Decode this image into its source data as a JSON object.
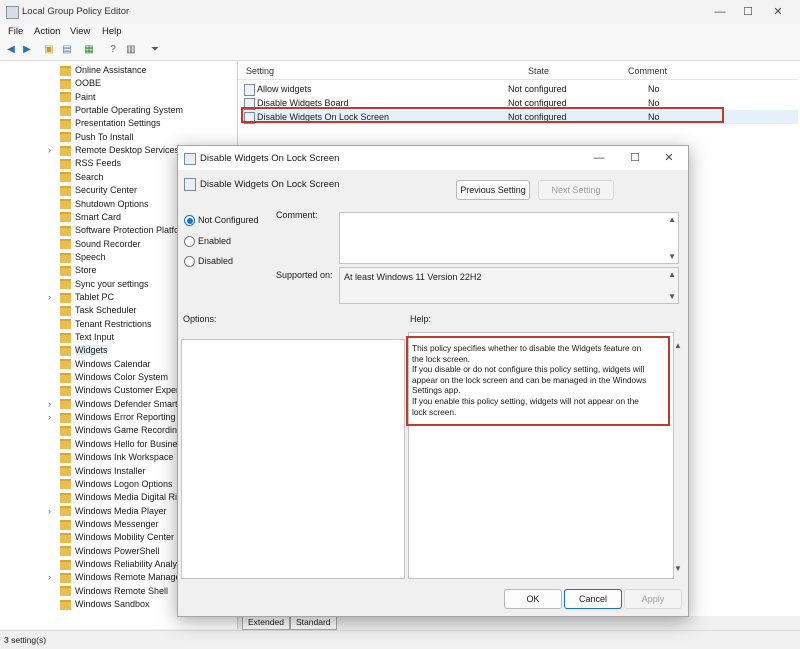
{
  "window": {
    "title": "Local Group Policy Editor"
  },
  "menu": [
    "File",
    "Action",
    "View",
    "Help"
  ],
  "tree": {
    "items": [
      {
        "label": "Online Assistance",
        "expander": false
      },
      {
        "label": "OOBE",
        "expander": false
      },
      {
        "label": "Paint",
        "expander": false
      },
      {
        "label": "Portable Operating System",
        "expander": false
      },
      {
        "label": "Presentation Settings",
        "expander": false
      },
      {
        "label": "Push To Install",
        "expander": false
      },
      {
        "label": "Remote Desktop Services",
        "expander": true
      },
      {
        "label": "RSS Feeds",
        "expander": false
      },
      {
        "label": "Search",
        "expander": false
      },
      {
        "label": "Security Center",
        "expander": false
      },
      {
        "label": "Shutdown Options",
        "expander": false
      },
      {
        "label": "Smart Card",
        "expander": false
      },
      {
        "label": "Software Protection Platfo",
        "expander": false
      },
      {
        "label": "Sound Recorder",
        "expander": false
      },
      {
        "label": "Speech",
        "expander": false
      },
      {
        "label": "Store",
        "expander": false
      },
      {
        "label": "Sync your settings",
        "expander": false
      },
      {
        "label": "Tablet PC",
        "expander": true
      },
      {
        "label": "Task Scheduler",
        "expander": false
      },
      {
        "label": "Tenant Restrictions",
        "expander": false
      },
      {
        "label": "Text Input",
        "expander": false
      },
      {
        "label": "Widgets",
        "expander": false,
        "selected": true
      },
      {
        "label": "Windows Calendar",
        "expander": false
      },
      {
        "label": "Windows Color System",
        "expander": false
      },
      {
        "label": "Windows Customer Exper",
        "expander": false
      },
      {
        "label": "Windows Defender Smart",
        "expander": true
      },
      {
        "label": "Windows Error Reporting",
        "expander": true
      },
      {
        "label": "Windows Game Recording",
        "expander": false
      },
      {
        "label": "Windows Hello for Busine",
        "expander": false
      },
      {
        "label": "Windows Ink Workspace",
        "expander": false
      },
      {
        "label": "Windows Installer",
        "expander": false
      },
      {
        "label": "Windows Logon Options",
        "expander": false
      },
      {
        "label": "Windows Media Digital Ri",
        "expander": false
      },
      {
        "label": "Windows Media Player",
        "expander": true
      },
      {
        "label": "Windows Messenger",
        "expander": false
      },
      {
        "label": "Windows Mobility Center",
        "expander": false
      },
      {
        "label": "Windows PowerShell",
        "expander": false
      },
      {
        "label": "Windows Reliability Analy",
        "expander": false
      },
      {
        "label": "Windows Remote Manage",
        "expander": true
      },
      {
        "label": "Windows Remote Shell",
        "expander": false
      },
      {
        "label": "Windows Sandbox",
        "expander": false
      }
    ]
  },
  "list": {
    "columns": {
      "setting": "Setting",
      "state": "State",
      "comment": "Comment"
    },
    "rows": [
      {
        "setting": "Allow widgets",
        "state": "Not configured",
        "comment": "No"
      },
      {
        "setting": "Disable Widgets Board",
        "state": "Not configured",
        "comment": "No"
      },
      {
        "setting": "Disable Widgets On Lock Screen",
        "state": "Not configured",
        "comment": "No"
      }
    ]
  },
  "bottom_tabs": [
    "Extended",
    "Standard"
  ],
  "status": "3 setting(s)",
  "dialog": {
    "title": "Disable Widgets On Lock Screen",
    "header": "Disable Widgets On Lock Screen",
    "previous_setting": "Previous Setting",
    "next_setting": "Next Setting",
    "options": [
      "Not Configured",
      "Enabled",
      "Disabled"
    ],
    "selected_option": "Not Configured",
    "comment_label": "Comment:",
    "supported_label": "Supported on:",
    "supported_value": "At least Windows 11 Version 22H2",
    "options_label": "Options:",
    "help_label": "Help:",
    "help_lines": [
      "This policy specifies whether to disable the Widgets feature on",
      "the lock screen.",
      "If you disable or do not configure this policy setting, widgets will",
      "appear on the lock screen and can be managed in the Windows",
      "Settings app.",
      "If you enable this policy setting, widgets will not appear on the",
      "lock screen."
    ],
    "ok": "OK",
    "cancel": "Cancel",
    "apply": "Apply"
  },
  "colors": {
    "highlight_border": "#c0392b",
    "radio_accent": "#1a6fcf",
    "folder": "#e8bd52"
  }
}
